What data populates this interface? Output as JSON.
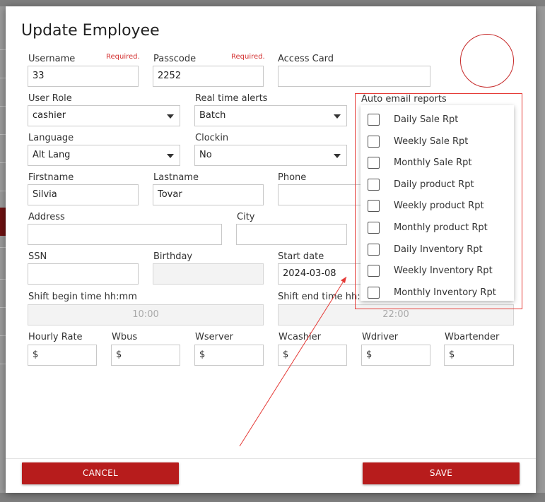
{
  "dialog": {
    "title": "Update Employee"
  },
  "fields": {
    "username": {
      "label": "Username",
      "required": "Required.",
      "value": "33"
    },
    "passcode": {
      "label": "Passcode",
      "required": "Required.",
      "value": "2252"
    },
    "access_card": {
      "label": "Access Card",
      "value": ""
    },
    "user_role": {
      "label": "User Role",
      "value": "cashier"
    },
    "realtime_alerts": {
      "label": "Real time alerts",
      "value": "Batch"
    },
    "auto_email": {
      "label": "Auto email reports"
    },
    "language": {
      "label": "Language",
      "value": "Alt Lang"
    },
    "clockin": {
      "label": "Clockin",
      "value": "No"
    },
    "firstname": {
      "label": "Firstname",
      "value": "Silvia"
    },
    "lastname": {
      "label": "Lastname",
      "value": "Tovar"
    },
    "phone": {
      "label": "Phone",
      "value": ""
    },
    "address": {
      "label": "Address",
      "value": ""
    },
    "city": {
      "label": "City",
      "value": ""
    },
    "ssn": {
      "label": "SSN",
      "value": ""
    },
    "birthday": {
      "label": "Birthday",
      "value": ""
    },
    "start_date": {
      "label": "Start date",
      "value": "2024-03-08"
    },
    "shift_begin": {
      "label": "Shift begin time hh:mm",
      "value": "10:00"
    },
    "shift_end": {
      "label": "Shift end time hh:mm",
      "value": "22:00"
    },
    "hourly_rate": {
      "label": "Hourly Rate",
      "value": "$"
    },
    "wbus": {
      "label": "Wbus",
      "value": "$"
    },
    "wserver": {
      "label": "Wserver",
      "value": "$"
    },
    "wcashier": {
      "label": "Wcashier",
      "value": "$"
    },
    "wdriver": {
      "label": "Wdriver",
      "value": "$"
    },
    "wbartender": {
      "label": "Wbartender",
      "value": "$"
    }
  },
  "reports": [
    {
      "label": "Daily Sale Rpt",
      "checked": false
    },
    {
      "label": "Weekly Sale Rpt",
      "checked": false
    },
    {
      "label": "Monthly Sale Rpt",
      "checked": false
    },
    {
      "label": "Daily product Rpt",
      "checked": false
    },
    {
      "label": "Weekly product Rpt",
      "checked": false
    },
    {
      "label": "Monthly product Rpt",
      "checked": false
    },
    {
      "label": "Daily Inventory Rpt",
      "checked": false
    },
    {
      "label": "Weekly Inventory Rpt",
      "checked": false
    },
    {
      "label": "Monthly Inventory Rpt",
      "checked": false
    }
  ],
  "buttons": {
    "cancel": "CANCEL",
    "save": "SAVE"
  },
  "colors": {
    "accent": "#b71c1c",
    "required": "#d32f2f",
    "annotation": "#e53935"
  }
}
